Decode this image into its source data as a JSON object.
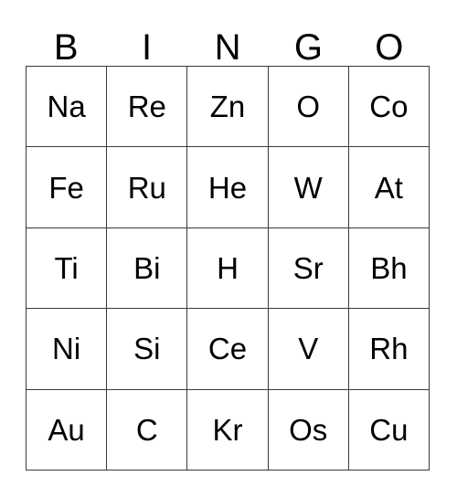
{
  "card": {
    "title": "BINGO",
    "header_letters": [
      "B",
      "I",
      "N",
      "G",
      "O"
    ],
    "colors": {
      "background": "#ffffff",
      "grid_line": "#3a3a3a",
      "text": "#000000"
    },
    "grid": {
      "columns": 5,
      "rows": 5,
      "cells": [
        [
          {
            "label": "Na"
          },
          {
            "label": "Re"
          },
          {
            "label": "Zn"
          },
          {
            "label": "O"
          },
          {
            "label": "Co"
          }
        ],
        [
          {
            "label": "Fe"
          },
          {
            "label": "Ru"
          },
          {
            "label": "He"
          },
          {
            "label": "W"
          },
          {
            "label": "At"
          }
        ],
        [
          {
            "label": "Ti"
          },
          {
            "label": "Bi"
          },
          {
            "label": "H"
          },
          {
            "label": "Sr"
          },
          {
            "label": "Bh"
          }
        ],
        [
          {
            "label": "Ni"
          },
          {
            "label": "Si"
          },
          {
            "label": "Ce"
          },
          {
            "label": "V"
          },
          {
            "label": "Rh"
          }
        ],
        [
          {
            "label": "Au"
          },
          {
            "label": "C"
          },
          {
            "label": "Kr"
          },
          {
            "label": "Os"
          },
          {
            "label": "Cu"
          }
        ]
      ]
    }
  }
}
